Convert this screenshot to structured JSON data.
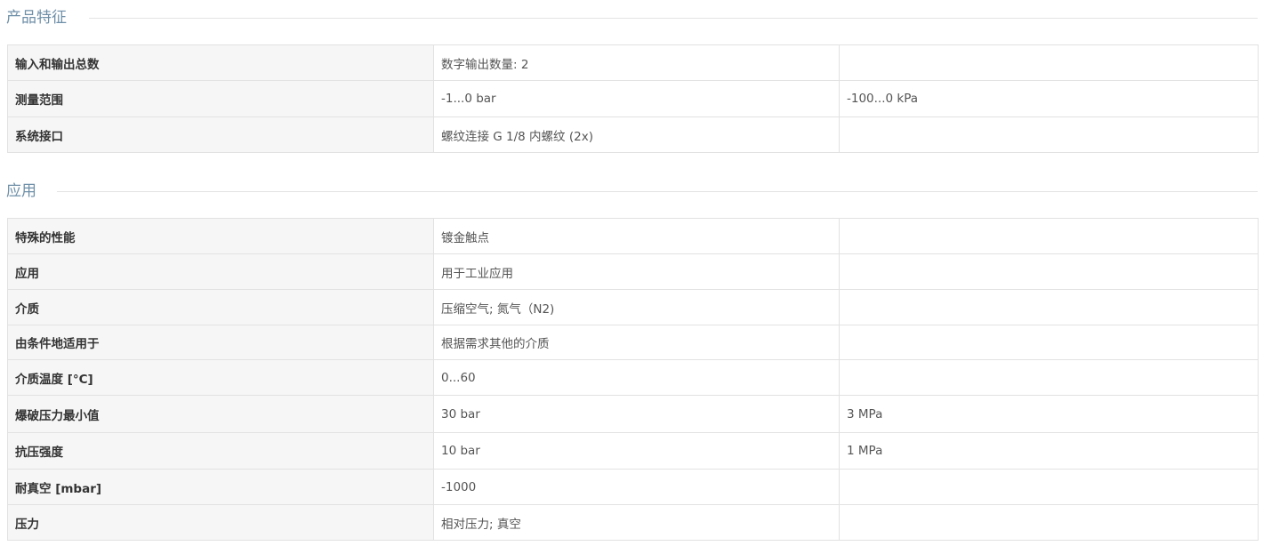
{
  "sections": [
    {
      "title": "产品特征",
      "rows": [
        {
          "label": "输入和输出总数",
          "value": "数字输出数量: 2",
          "value2": ""
        },
        {
          "label": "测量范围",
          "value": "-1...0 bar",
          "value2": "-100...0 kPa"
        },
        {
          "label": "系统接口",
          "value": "螺纹连接 G 1/8 内螺纹 (2x)",
          "value2": ""
        }
      ]
    },
    {
      "title": "应用",
      "rows": [
        {
          "label": "特殊的性能",
          "value": "镀金触点",
          "value2": ""
        },
        {
          "label": "应用",
          "value": "用于工业应用",
          "value2": ""
        },
        {
          "label": "介质",
          "value": "压缩空气; 氮气（N2)",
          "value2": ""
        },
        {
          "label": "由条件地适用于",
          "value": "根据需求其他的介质",
          "value2": ""
        },
        {
          "label": "介质温度 [°C]",
          "value": "0...60",
          "value2": ""
        },
        {
          "label": "爆破压力最小值",
          "value": "30 bar",
          "value2": "3 MPa"
        },
        {
          "label": "抗压强度",
          "value": "10 bar",
          "value2": "1 MPa"
        },
        {
          "label": "耐真空 [mbar]",
          "value": "-1000",
          "value2": ""
        },
        {
          "label": "压力",
          "value": "相对压力; 真空",
          "value2": ""
        }
      ]
    }
  ]
}
